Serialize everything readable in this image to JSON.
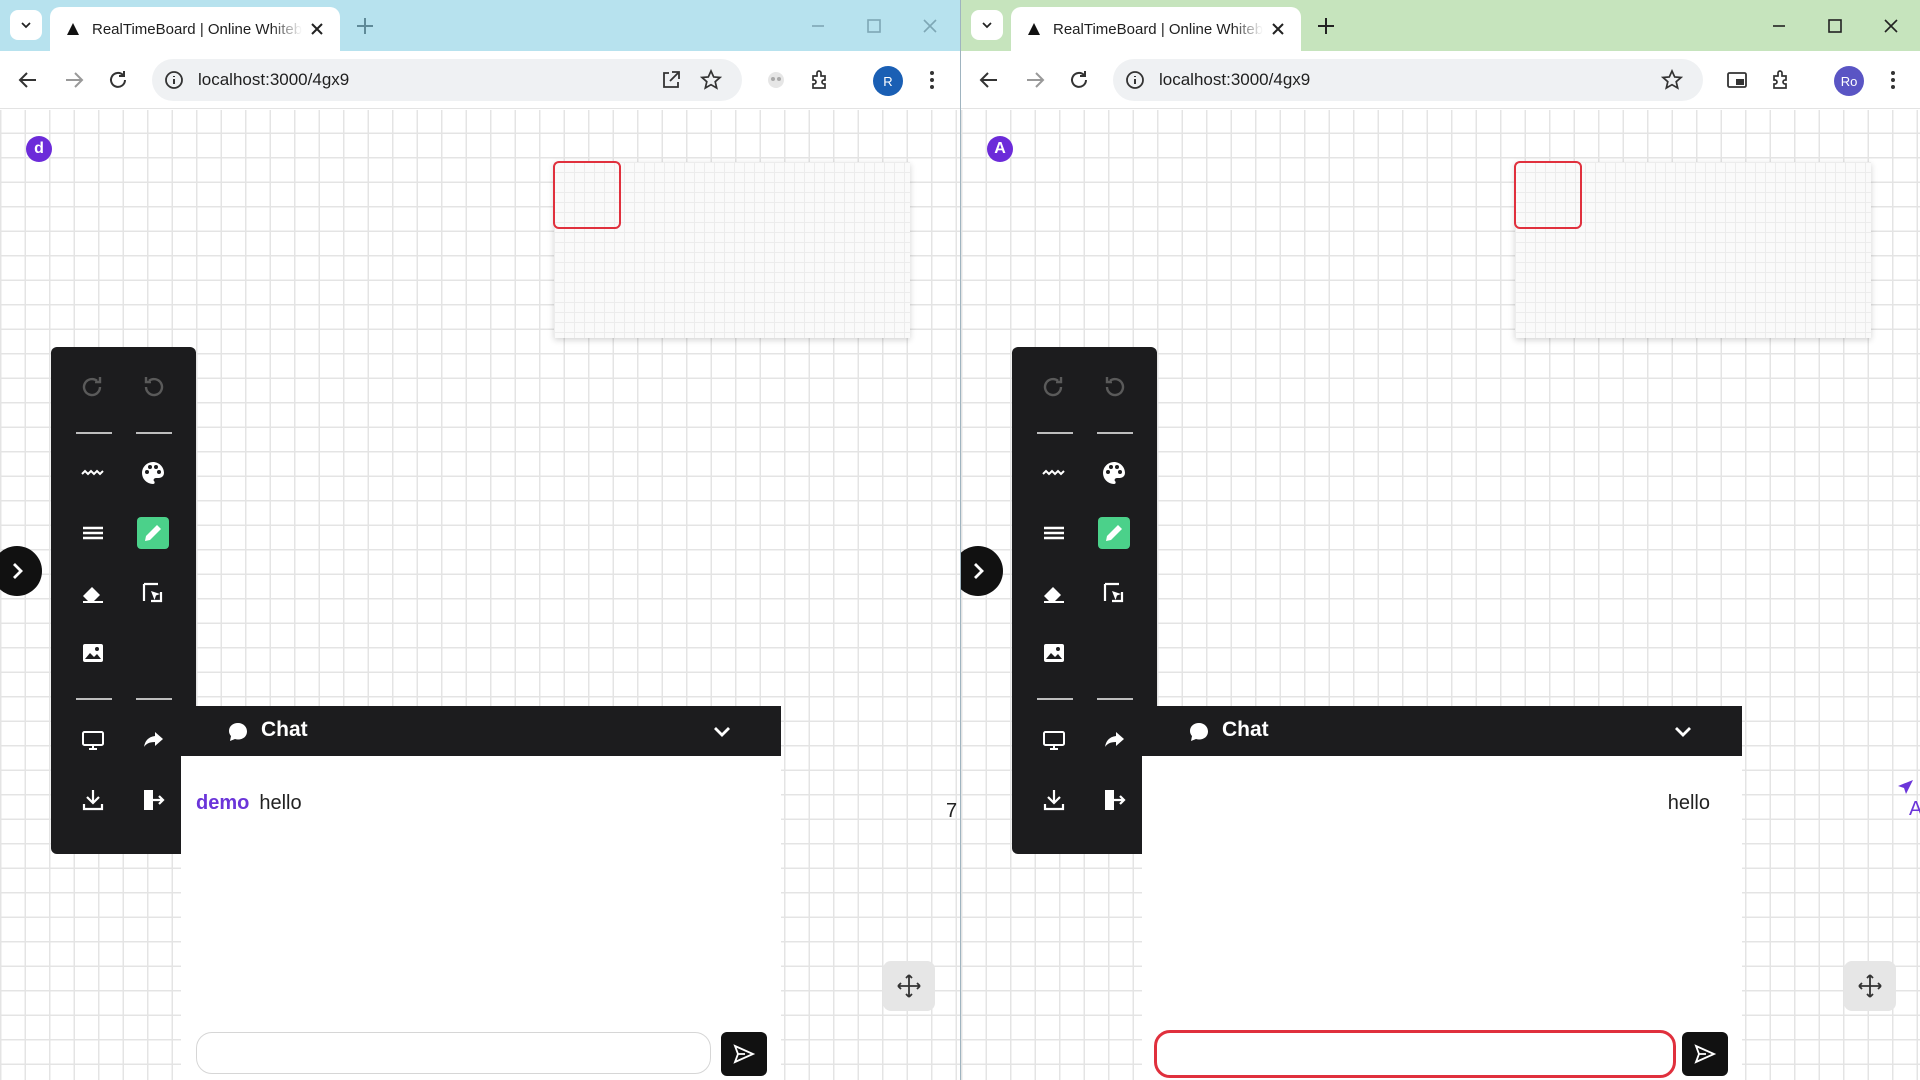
{
  "colors": {
    "left_tabstrip": "#b7e2ee",
    "right_tabstrip": "#c6e4bd",
    "accent_purple": "#6c2bd9",
    "active_tool_green": "#4bd18a",
    "focus_red": "#e0303d",
    "panel_dark": "#1c1c1e"
  },
  "left": {
    "tab_title": "RealTimeBoard | Online Whiteboard",
    "url": "localhost:3000/4gx9",
    "profile_initial": "R",
    "presence_initial": "d",
    "chat": {
      "title": "Chat",
      "message_author": "demo",
      "message_text": "hello",
      "input_value": ""
    },
    "stray_text": "7"
  },
  "right": {
    "tab_title": "RealTimeBoard | Online Whiteboard",
    "url": "localhost:3000/4gx9",
    "profile_initial": "Ro",
    "presence_initial": "A",
    "chat": {
      "title": "Chat",
      "message_text": "hello",
      "input_value": ""
    },
    "remote_cursor_label": "A"
  },
  "icons": {
    "tools": [
      "redo-icon",
      "undo-icon",
      "stroke-style-icon",
      "palette-icon",
      "line-width-icon",
      "pencil-icon",
      "eraser-icon",
      "select-icon",
      "image-icon",
      "present-icon",
      "share-icon",
      "download-icon",
      "exit-icon"
    ],
    "chat": [
      "chat-bubble-icon",
      "chevron-down-icon",
      "send-icon"
    ],
    "misc": [
      "move-icon",
      "expand-arrow-icon"
    ]
  }
}
